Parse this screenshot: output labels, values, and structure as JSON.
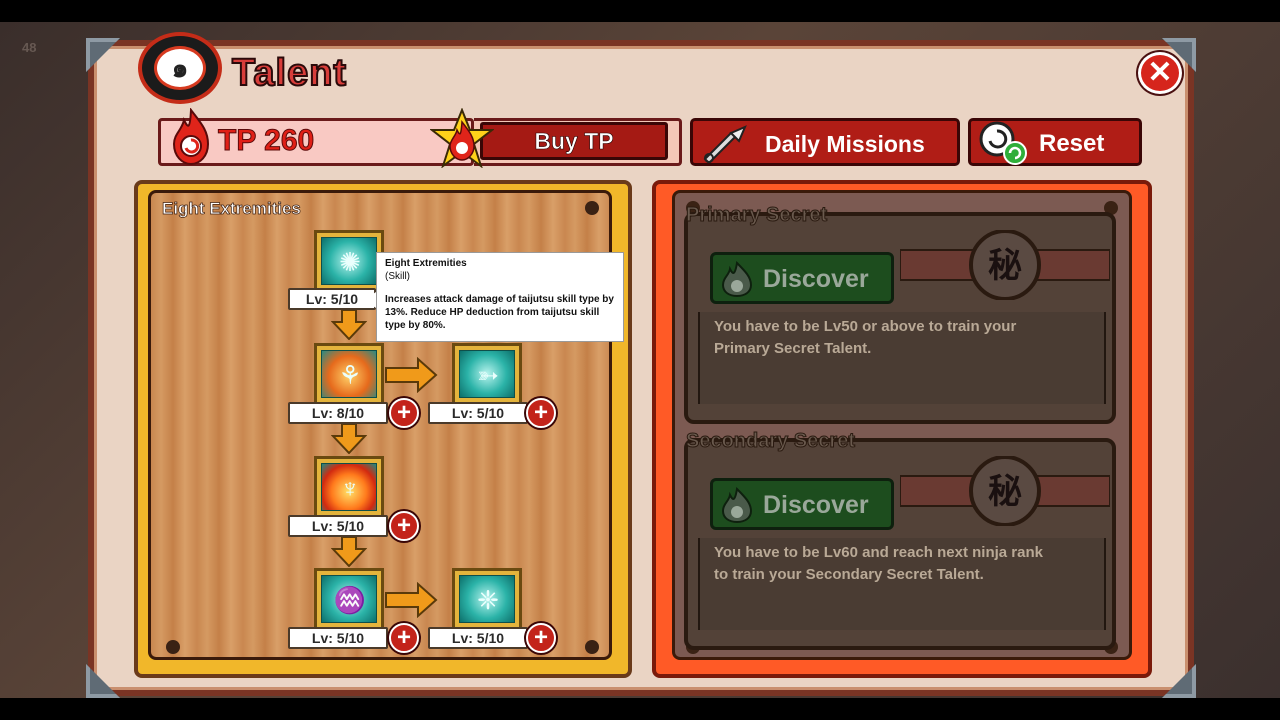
{
  "window": {
    "title": "Talent",
    "close_icon": "close-icon"
  },
  "currency": {
    "label": "TP 260",
    "buy_label": "Buy TP"
  },
  "toolbar": {
    "daily_label": "Daily Missions",
    "reset_label": "Reset"
  },
  "background": {
    "top_left": "48"
  },
  "left_panel": {
    "title": "Eight Extremities",
    "tooltip": {
      "name": "Eight Extremities",
      "type": "(Skill)",
      "description": "Increases attack damage of taijutsu skill type by 13%. Reduce HP deduction from taijutsu skill type by 80%."
    },
    "skills": [
      {
        "level": "Lv: 5/10",
        "icon": "energy-burst-icon"
      },
      {
        "level": "Lv: 8/10",
        "icon": "multi-arm-body-icon"
      },
      {
        "level": "Lv: 5/10",
        "icon": "spiral-spear-icon"
      },
      {
        "level": "Lv: 5/10",
        "icon": "flame-wings-icon"
      },
      {
        "level": "Lv: 5/10",
        "icon": "water-figure-icon"
      },
      {
        "level": "Lv: 5/10",
        "icon": "shatter-icon"
      }
    ]
  },
  "right_panel": {
    "primary": {
      "title": "Primary Secret",
      "button": "Discover",
      "requirement": "You have to be Lv50 or above to train your Primary Secret Talent."
    },
    "secondary": {
      "title": "Secondary Secret",
      "button": "Discover",
      "requirement": "You have to be Lv60 and reach next ninja rank to train your Secondary Secret Talent."
    },
    "seal_text": "秘"
  },
  "colors": {
    "accent_red": "#b01d16",
    "panel_gold": "#f1b72a",
    "panel_orange": "#ff5a26",
    "discover_green": "#1d4d1e"
  }
}
